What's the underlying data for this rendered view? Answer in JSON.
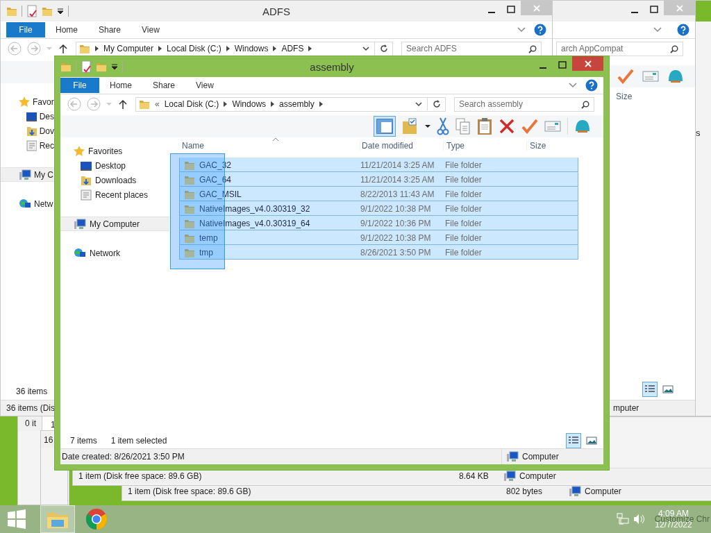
{
  "adfs_window": {
    "title": "ADFS",
    "ribbon_tabs": [
      {
        "label": "File",
        "kind": "file"
      },
      {
        "label": "Home",
        "kind": "tab"
      },
      {
        "label": "Share",
        "kind": "tab"
      },
      {
        "label": "View",
        "kind": "tab"
      }
    ],
    "address": [
      "My Computer",
      "Local Disk (C:)",
      "Windows",
      "ADFS"
    ],
    "search_placeholder": "Search ADFS",
    "nav": [
      {
        "label": "Favor",
        "kind": "favorites",
        "selected": false,
        "children": [
          {
            "label": "Des",
            "kind": "desktop",
            "selected": false
          },
          {
            "label": "Dov",
            "kind": "downloads",
            "selected": false
          },
          {
            "label": "Rec",
            "kind": "recent",
            "selected": false
          }
        ]
      },
      {
        "label": "My C",
        "kind": "computer",
        "selected": true
      },
      {
        "label": "Netw",
        "kind": "network",
        "selected": false
      }
    ],
    "item_count": "36 items",
    "status": "36 items (Dis"
  },
  "appcompat_window": {
    "search_placeholder": "arch AppCompat",
    "column": "Size",
    "status": "mputer"
  },
  "right_window": {
    "text": "s"
  },
  "lower_windows": [
    {
      "status": "0 it"
    },
    {
      "status": "1"
    },
    {
      "status": "16"
    },
    {
      "status": "1 item (Disk free space: 89.6 GB)",
      "size": "8.64 KB",
      "zone": "Computer"
    },
    {
      "status": "1 item (Disk free space: 89.6 GB)",
      "size": "802 bytes",
      "zone": "Computer"
    }
  ],
  "main_window": {
    "title": "assembly",
    "ribbon_tabs": [
      {
        "label": "File",
        "kind": "file"
      },
      {
        "label": "Home",
        "kind": "tab"
      },
      {
        "label": "Share",
        "kind": "tab"
      },
      {
        "label": "View",
        "kind": "tab"
      }
    ],
    "address_prefix": "«",
    "address": [
      "Local Disk (C:)",
      "Windows",
      "assembly"
    ],
    "search_placeholder": "Search assembly",
    "layout_button_on": true,
    "nav": [
      {
        "label": "Favorites",
        "kind": "favorites",
        "selected": false,
        "children": [
          {
            "label": "Desktop",
            "kind": "desktop",
            "selected": false
          },
          {
            "label": "Downloads",
            "kind": "downloads",
            "selected": false
          },
          {
            "label": "Recent places",
            "kind": "recent",
            "selected": false
          }
        ]
      },
      {
        "label": "My Computer",
        "kind": "computer",
        "selected": true
      },
      {
        "label": "Network",
        "kind": "network",
        "selected": false
      }
    ],
    "columns": [
      "Name",
      "Date modified",
      "Type",
      "Size"
    ],
    "rows": [
      {
        "name": "GAC_32",
        "date": "11/21/2014 3:25 AM",
        "type": "File folder",
        "selected": true
      },
      {
        "name": "GAC_64",
        "date": "11/21/2014 3:25 AM",
        "type": "File folder",
        "selected": true
      },
      {
        "name": "GAC_MSIL",
        "date": "8/22/2013 11:43 AM",
        "type": "File folder",
        "selected": true
      },
      {
        "name": "NativeImages_v4.0.30319_32",
        "date": "9/1/2022 10:38 PM",
        "type": "File folder",
        "selected": true
      },
      {
        "name": "NativeImages_v4.0.30319_64",
        "date": "9/1/2022 10:36 PM",
        "type": "File folder",
        "selected": true
      },
      {
        "name": "temp",
        "date": "9/1/2022 10:38 PM",
        "type": "File folder",
        "selected": true
      },
      {
        "name": "tmp",
        "date": "8/26/2021 3:50 PM",
        "type": "File folder",
        "selected": true
      }
    ],
    "item_count": "7 items",
    "selection_count": "1 item selected",
    "view_buttons": [
      {
        "kind": "details",
        "selected": true
      },
      {
        "kind": "thumbnails",
        "selected": false
      }
    ],
    "details": "Date created: 8/26/2021 3:50 PM",
    "zone": "Computer"
  },
  "taskbar": {
    "apps": [
      {
        "kind": "explorer",
        "active": true
      },
      {
        "kind": "chrome",
        "active": false
      }
    ],
    "notification": "Customize Chr",
    "time": "4:09 AM",
    "date": "12/7/2022"
  }
}
